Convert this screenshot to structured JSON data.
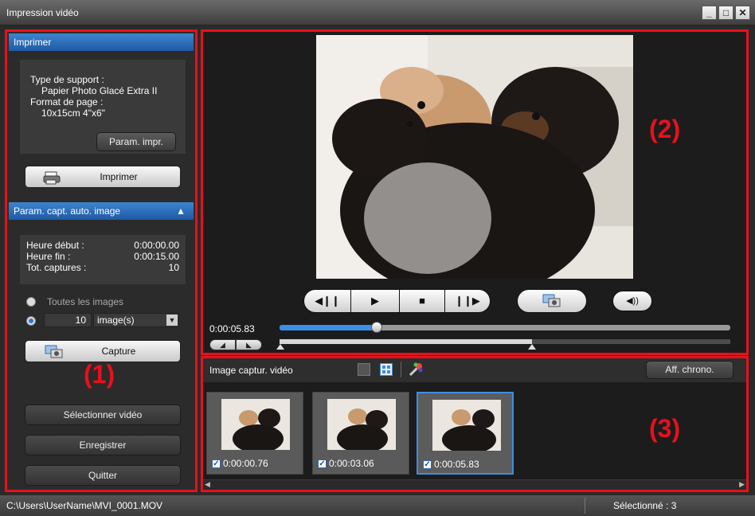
{
  "window": {
    "title": "Impression vidéo"
  },
  "print_section": {
    "header": "Imprimer",
    "media_type_label": "Type de support :",
    "media_type_value": "Papier Photo Glacé Extra II",
    "page_size_label": "Format de page :",
    "page_size_value": "10x15cm 4\"x6\"",
    "settings_button": "Param. impr.",
    "print_button": "Imprimer"
  },
  "auto_capture": {
    "header": "Param. capt. auto. image",
    "start_label": "Heure début :",
    "start_value": "0:00:00.00",
    "end_label": "Heure fin :",
    "end_value": "0:00:15.00",
    "total_label": "Tot. captures :",
    "total_value": "10",
    "all_images_label": "Toutes les images",
    "count_value": "10",
    "unit_selected": "image(s)",
    "capture_button": "Capture"
  },
  "left_buttons": {
    "select_video": "Sélectionner vidéo",
    "save": "Enregistrer",
    "quit": "Quitter"
  },
  "playback": {
    "current_time": "0:00:05.83",
    "progress": 0.215,
    "range_end": 0.56
  },
  "thumbnails": {
    "header": "Image captur. vidéo",
    "timeline_button": "Aff. chrono.",
    "items": [
      {
        "time": "0:00:00.76",
        "checked": true
      },
      {
        "time": "0:00:03.06",
        "checked": true
      },
      {
        "time": "0:00:05.83",
        "checked": true
      }
    ]
  },
  "labels": {
    "one": "(1)",
    "two": "(2)",
    "three": "(3)"
  },
  "status": {
    "path": "C:\\Users\\UserName\\MVI_0001.MOV",
    "selected": "Sélectionné : 3"
  },
  "colors": {
    "accent_red": "#e8101c",
    "header_blue": "#2a6bbd",
    "selection_blue": "#3b8fe6"
  }
}
